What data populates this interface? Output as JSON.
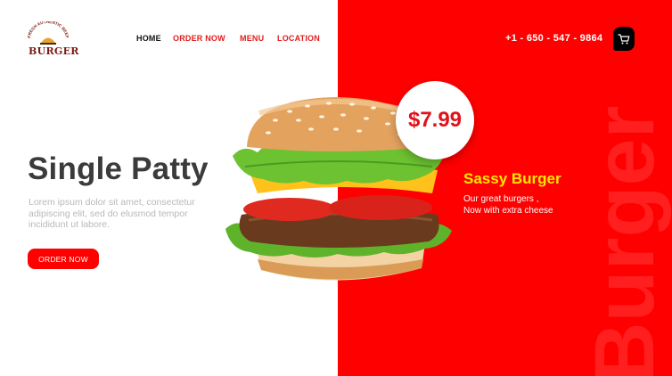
{
  "brand": {
    "logo_top_text": "FRESH AUTHENTIC BEEF",
    "logo_word": "BURGER",
    "logo_icon": "burger-logo-icon"
  },
  "nav": {
    "home": "HOME",
    "order_now": "ORDER NOW",
    "menu": "MENU",
    "location": "LOCATION"
  },
  "contact": {
    "phone": "+1 - 650 - 547 - 9864"
  },
  "cart": {
    "icon": "cart-icon"
  },
  "hero": {
    "title": "Single Patty",
    "description": "Lorem ipsum dolor sit amet, consectetur adipiscing elit, sed do elusmod tempor incididunt ut labore.",
    "cta_label": "ORDER NOW"
  },
  "product": {
    "price": "$7.99",
    "name": "Sassy Burger",
    "desc_line1": "Our great burgers ,",
    "desc_line2": "Now with extra cheese",
    "image": "burger-image"
  },
  "watermark": "Burger",
  "colors": {
    "accent": "#ff0000",
    "title_text": "#3b3b3b",
    "product_name": "#ffe600",
    "price_text": "#e0121a",
    "nav_active": "#111111",
    "nav_link": "#e11d1d"
  }
}
